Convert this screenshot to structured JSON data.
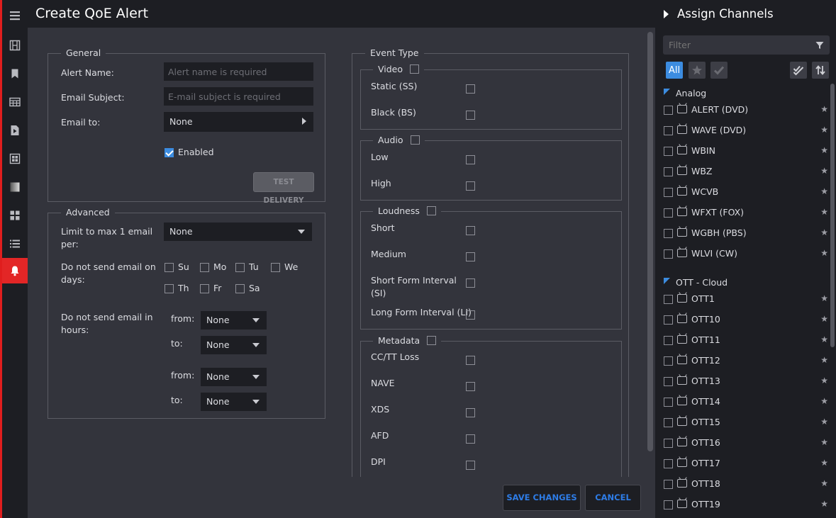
{
  "header": {
    "title": "Create QoE Alert"
  },
  "nav": {
    "items": [
      {
        "icon": "menu-icon"
      },
      {
        "icon": "film-icon"
      },
      {
        "icon": "bookmark-icon"
      },
      {
        "icon": "table-icon"
      },
      {
        "icon": "play-file-icon"
      },
      {
        "icon": "grid-view-icon"
      },
      {
        "icon": "gradient-icon"
      },
      {
        "icon": "dashboard-icon"
      },
      {
        "icon": "list-icon"
      },
      {
        "icon": "bell-icon"
      }
    ]
  },
  "general": {
    "legend": "General",
    "alert_name_label": "Alert Name:",
    "alert_name_placeholder": "Alert name is required",
    "email_subject_label": "Email Subject:",
    "email_subject_placeholder": "E-mail subject is required",
    "email_to_label": "Email to:",
    "email_to_value": "None",
    "enabled_label": "Enabled",
    "test_delivery_label": "TEST DELIVERY"
  },
  "advanced": {
    "legend": "Advanced",
    "limit_label": "Limit to max 1 email per:",
    "limit_value": "None",
    "days_label": "Do not send email on days:",
    "days": [
      "Su",
      "Mo",
      "Tu",
      "We",
      "Th",
      "Fr",
      "Sa"
    ],
    "hours_label": "Do not send email in hours:",
    "from_label": "from:",
    "to_label": "to:",
    "from1": "None",
    "to1": "None",
    "from2": "None",
    "to2": "None"
  },
  "event_type": {
    "legend": "Event Type",
    "video": {
      "legend": "Video",
      "items": [
        "Static (SS)",
        "Black (BS)"
      ]
    },
    "audio": {
      "legend": "Audio",
      "items": [
        "Low",
        "High"
      ]
    },
    "loudness": {
      "legend": "Loudness",
      "items": [
        "Short",
        "Medium",
        "Short Form Interval (SI)",
        "Long Form Interval (LI)"
      ]
    },
    "metadata": {
      "legend": "Metadata",
      "items": [
        "CC/TT Loss",
        "NAVE",
        "XDS",
        "AFD",
        "DPI"
      ]
    }
  },
  "footer": {
    "save_label": "SAVE CHANGES",
    "cancel_label": "CANCEL"
  },
  "channels": {
    "title": "Assign Channels",
    "filter_placeholder": "Filter",
    "all_label": "All",
    "groups": [
      {
        "name": "Analog",
        "channels": [
          "ALERT (DVD)",
          "WAVE (DVD)",
          "WBIN",
          "WBZ",
          "WCVB",
          "WFXT (FOX)",
          "WGBH (PBS)",
          "WLVI (CW)"
        ]
      },
      {
        "name": "OTT - Cloud",
        "channels": [
          "OTT1",
          "OTT10",
          "OTT11",
          "OTT12",
          "OTT13",
          "OTT14",
          "OTT15",
          "OTT16",
          "OTT17",
          "OTT18",
          "OTT19"
        ]
      }
    ]
  },
  "colors": {
    "accent": "#3c8ce0",
    "alert_red": "#e32626",
    "primary_text": "#2e7ce6"
  }
}
